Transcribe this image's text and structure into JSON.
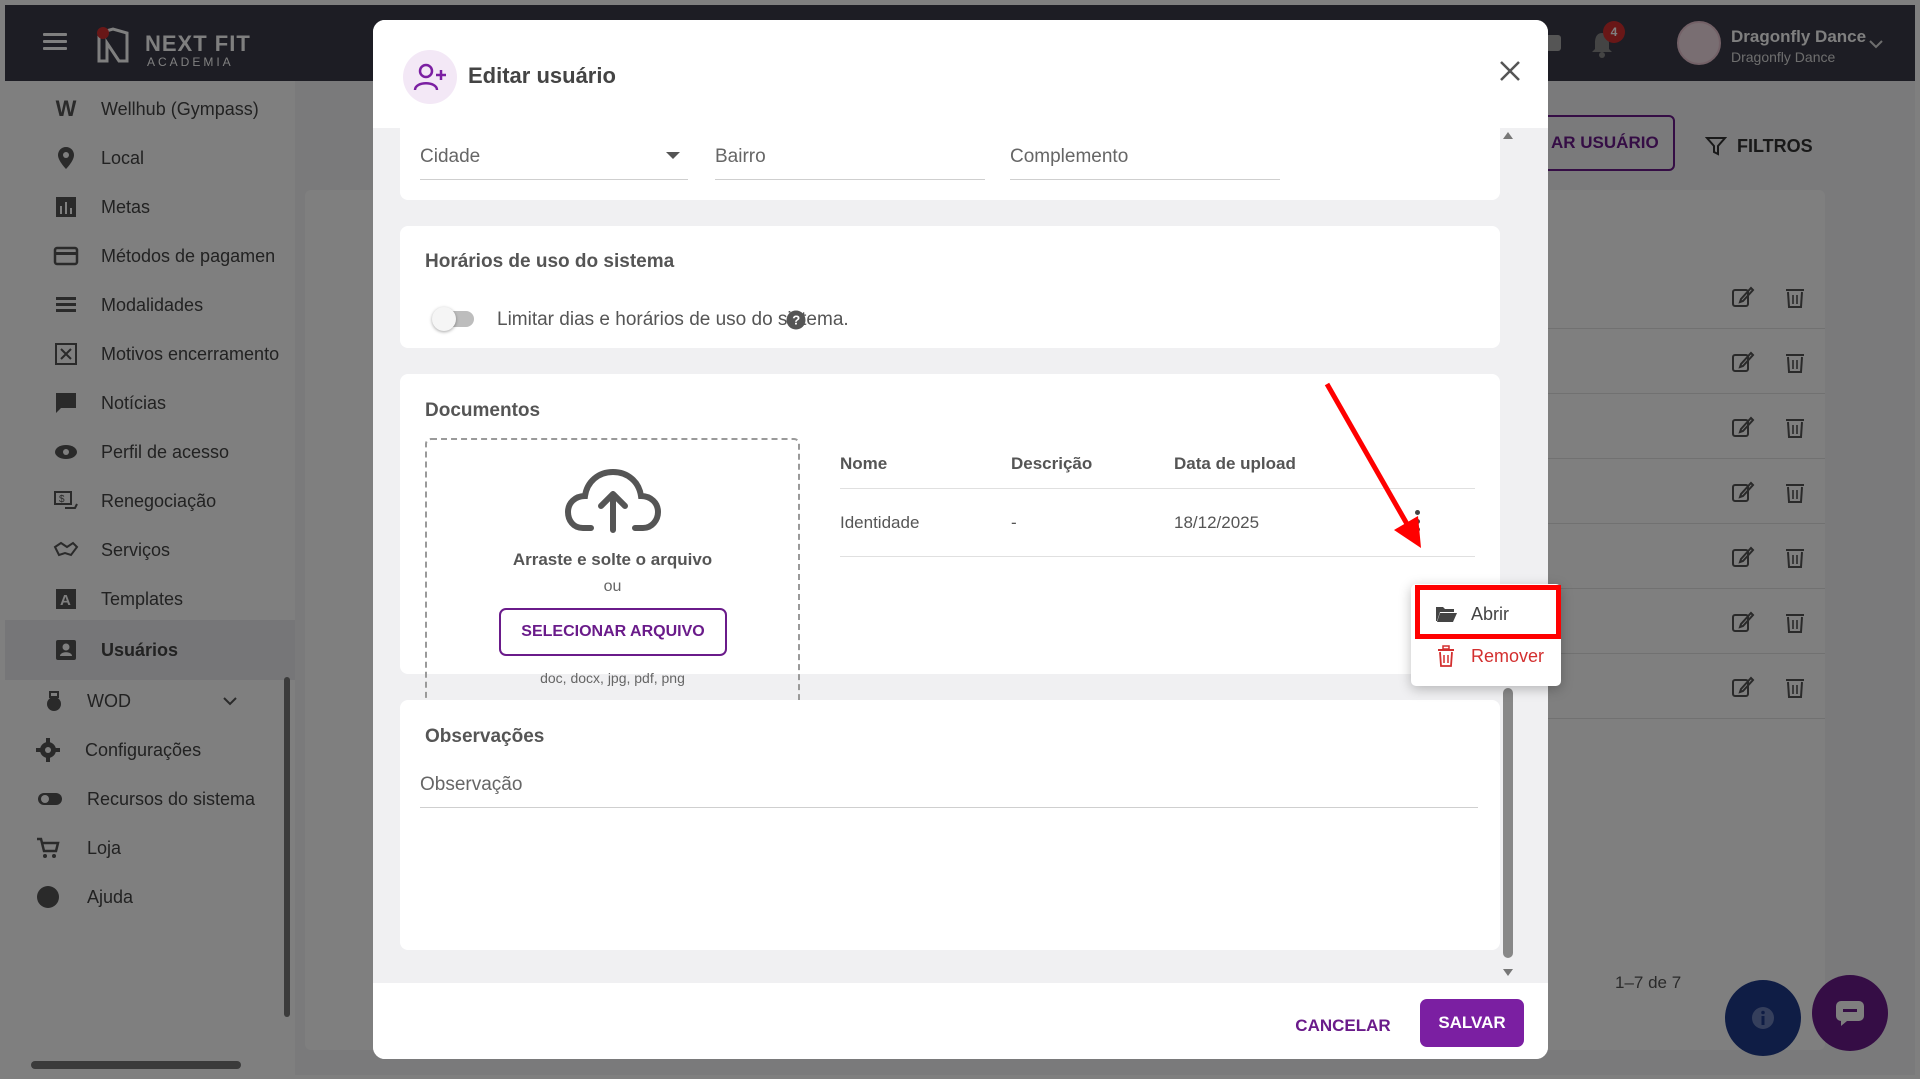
{
  "topbar": {
    "logo_name": "NEXT FIT",
    "logo_sub": "ACADEMIA",
    "notification_count": "4",
    "user_name": "Dragonfly Dance",
    "user_sub": "Dragonfly Dance"
  },
  "sidebar": {
    "items": [
      {
        "label": "Wellhub (Gympass)",
        "icon": "wellhub-icon"
      },
      {
        "label": "Local",
        "icon": "location-pin-icon"
      },
      {
        "label": "Metas",
        "icon": "bar-chart-icon"
      },
      {
        "label": "Métodos de pagamen",
        "icon": "credit-card-icon"
      },
      {
        "label": "Modalidades",
        "icon": "list-icon"
      },
      {
        "label": "Motivos encerramento",
        "icon": "close-box-icon"
      },
      {
        "label": "Notícias",
        "icon": "message-icon"
      },
      {
        "label": "Perfil de acesso",
        "icon": "eye-icon"
      },
      {
        "label": "Renegociação",
        "icon": "money-icon"
      },
      {
        "label": "Serviços",
        "icon": "handshake-icon"
      },
      {
        "label": "Templates",
        "icon": "template-icon"
      },
      {
        "label": "Usuários",
        "icon": "user-badge-icon",
        "active": true
      },
      {
        "label": "WOD",
        "icon": "kettlebell-icon"
      },
      {
        "label": "Configurações",
        "icon": "gear-icon"
      },
      {
        "label": "Recursos do sistema",
        "icon": "toggle-icon"
      },
      {
        "label": "Loja",
        "icon": "cart-icon"
      },
      {
        "label": "Ajuda",
        "icon": "help-icon"
      }
    ]
  },
  "background": {
    "add_user_button": "AR USUÁRIO",
    "filters_button": "FILTROS",
    "pager_text": "1–7 de 7",
    "row_count": 7
  },
  "modal": {
    "title": "Editar usuário",
    "address": {
      "city_label": "Cidade",
      "neighborhood_label": "Bairro",
      "complement_label": "Complemento"
    },
    "schedule": {
      "title": "Horários de uso do sistema",
      "toggle_label": "Limitar dias e horários de uso do sistema.",
      "toggle_on": false
    },
    "documents": {
      "title": "Documentos",
      "drop_text": "Arraste e solte o arquivo",
      "or_text": "ou",
      "select_button": "SELECIONAR ARQUIVO",
      "formats": "doc, docx, jpg, pdf, png",
      "columns": [
        "Nome",
        "Descrição",
        "Data de upload"
      ],
      "rows": [
        {
          "name": "Identidade",
          "description": "-",
          "upload_date": "18/12/2025"
        }
      ]
    },
    "notes": {
      "title": "Observações",
      "field_label": "Observação"
    },
    "cancel_button": "CANCELAR",
    "save_button": "SALVAR"
  },
  "context_menu": {
    "open_label": "Abrir",
    "remove_label": "Remover"
  },
  "colors": {
    "primary": "#7b1fa2",
    "danger": "#d32f2f",
    "annotation": "#ff0000"
  }
}
